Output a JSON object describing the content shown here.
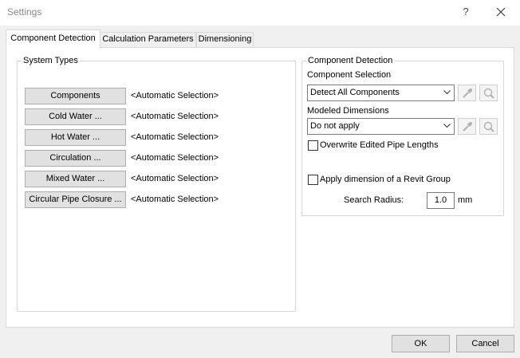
{
  "window": {
    "title": "Settings",
    "help_label": "?"
  },
  "tabs": [
    {
      "label": "Component Detection",
      "active": true
    },
    {
      "label": "Calculation Parameters",
      "active": false
    },
    {
      "label": "Dimensioning",
      "active": false
    }
  ],
  "system_types": {
    "title": "System Types",
    "items": [
      {
        "button": "Components",
        "value": "<Automatic Selection>"
      },
      {
        "button": "Cold Water ...",
        "value": "<Automatic Selection>"
      },
      {
        "button": "Hot Water ...",
        "value": "<Automatic Selection>"
      },
      {
        "button": "Circulation ...",
        "value": "<Automatic Selection>"
      },
      {
        "button": "Mixed Water ...",
        "value": "<Automatic Selection>"
      },
      {
        "button": "Circular Pipe Closure ...",
        "value": "<Automatic Selection>"
      }
    ]
  },
  "component_detection": {
    "title": "Component Detection",
    "component_selection_label": "Component Selection",
    "component_selection_value": "Detect All Components",
    "modeled_dimensions_label": "Modeled Dimensions",
    "modeled_dimensions_value": "Do not apply",
    "overwrite_label": "Overwrite Edited Pipe Lengths",
    "overwrite_checked": false,
    "revit_group_label": "Apply dimension of a Revit Group",
    "revit_group_checked": false,
    "search_radius_label": "Search Radius:",
    "search_radius_value": "1.0",
    "search_radius_unit": "mm"
  },
  "footer": {
    "ok_label": "OK",
    "cancel_label": "Cancel"
  },
  "icons": {
    "pick": "eyedropper-icon",
    "search": "magnifier-icon",
    "dropdown": "chevron-down-icon",
    "close": "close-icon"
  }
}
